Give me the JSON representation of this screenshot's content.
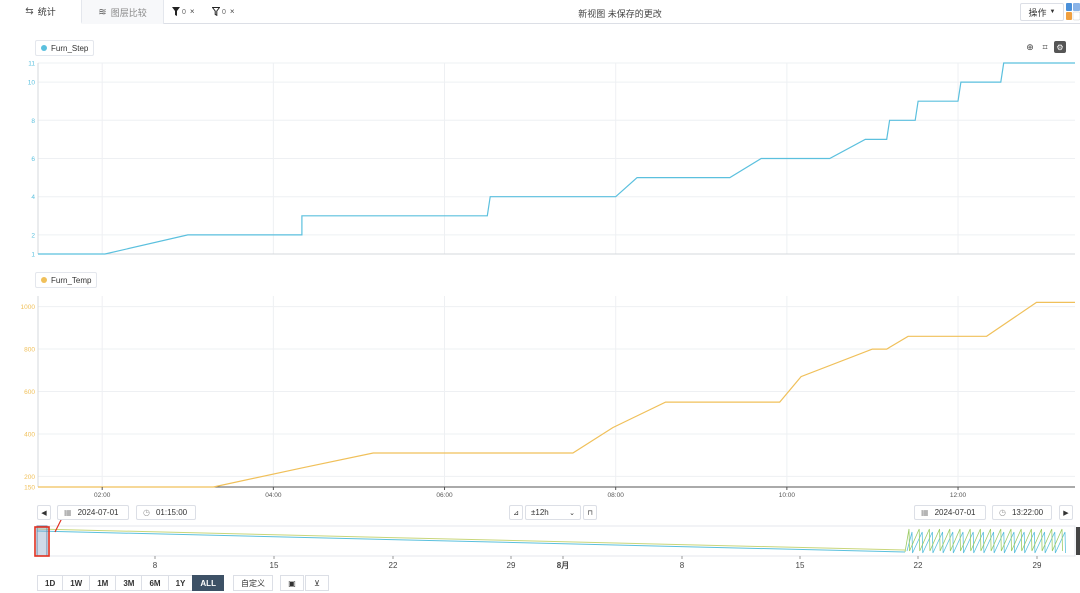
{
  "tabs": [
    {
      "label": "统计",
      "icon": "swap-icon"
    },
    {
      "label": "图层比较",
      "icon": "layers-icon"
    }
  ],
  "filters": [
    {
      "count": "0",
      "icon": "filter-filled-icon"
    },
    {
      "count": "0",
      "icon": "filter-outline-icon"
    }
  ],
  "view_title": "新视图 未保存的更改",
  "operations_label": "操作",
  "charts": {
    "step": {
      "legend": "Furn_Step",
      "color": "#5bc0de"
    },
    "temp": {
      "legend": "Furn_Temp",
      "color": "#f0c05a"
    }
  },
  "chart_data": [
    {
      "type": "line",
      "line_shape": "step",
      "series": [
        {
          "name": "Furn_Step",
          "color": "#5bc0de",
          "x": [
            "01:15",
            "02:02",
            "03:00",
            "04:20",
            "04:20",
            "05:18",
            "06:30",
            "06:32",
            "07:30",
            "08:00",
            "08:15",
            "09:20",
            "09:42",
            "10:30",
            "10:55",
            "11:10",
            "11:12",
            "11:30",
            "11:32",
            "12:00",
            "12:02",
            "12:30",
            "12:32",
            "13:22"
          ],
          "y": [
            1,
            1,
            2,
            2,
            3,
            3,
            3,
            4,
            4,
            4,
            5,
            5,
            6,
            6,
            7,
            7,
            8,
            8,
            9,
            9,
            10,
            10,
            11,
            11
          ]
        }
      ],
      "ylim": [
        1,
        11
      ],
      "yticks": [
        "1",
        "2",
        "4",
        "6",
        "8",
        "10",
        "11"
      ],
      "xlim": [
        "01:15",
        "13:22"
      ],
      "xticks": [
        "02:00",
        "04:00",
        "06:00",
        "08:00",
        "10:00",
        "12:00"
      ],
      "grid": true,
      "legend": "top-left"
    },
    {
      "type": "line",
      "series": [
        {
          "name": "Furn_Temp",
          "color": "#f0c05a",
          "x": [
            "01:15",
            "02:02",
            "03:00",
            "03:18",
            "04:20",
            "05:10",
            "06:00",
            "06:35",
            "07:30",
            "07:58",
            "08:35",
            "09:10",
            "09:55",
            "10:10",
            "11:00",
            "11:10",
            "11:25",
            "12:05",
            "12:20",
            "12:55",
            "13:22"
          ],
          "y": [
            150,
            150,
            150,
            150,
            240,
            310,
            310,
            310,
            310,
            430,
            550,
            550,
            550,
            670,
            800,
            800,
            860,
            860,
            860,
            1020,
            1020
          ]
        }
      ],
      "ylim": [
        150,
        1050
      ],
      "yticks": [
        "150",
        "200",
        "400",
        "600",
        "800",
        "1000"
      ],
      "xlim": [
        "01:15",
        "13:22"
      ],
      "xticks": [
        "02:00",
        "04:00",
        "06:00",
        "08:00",
        "10:00",
        "12:00"
      ],
      "grid": true,
      "legend": "top-left"
    }
  ],
  "range_controls": {
    "start_date": "2024-07-01",
    "start_time": "01:15:00",
    "window": "±12h",
    "end_date": "2024-07-01",
    "end_time": "13:22:00"
  },
  "navigator": {
    "ticks": [
      "8",
      "15",
      "22",
      "29",
      "8月",
      "8",
      "15",
      "22",
      "29"
    ]
  },
  "range_buttons": [
    "1D",
    "1W",
    "1M",
    "3M",
    "6M",
    "1Y",
    "ALL"
  ],
  "active_range": "ALL",
  "custom_label": "自定义"
}
